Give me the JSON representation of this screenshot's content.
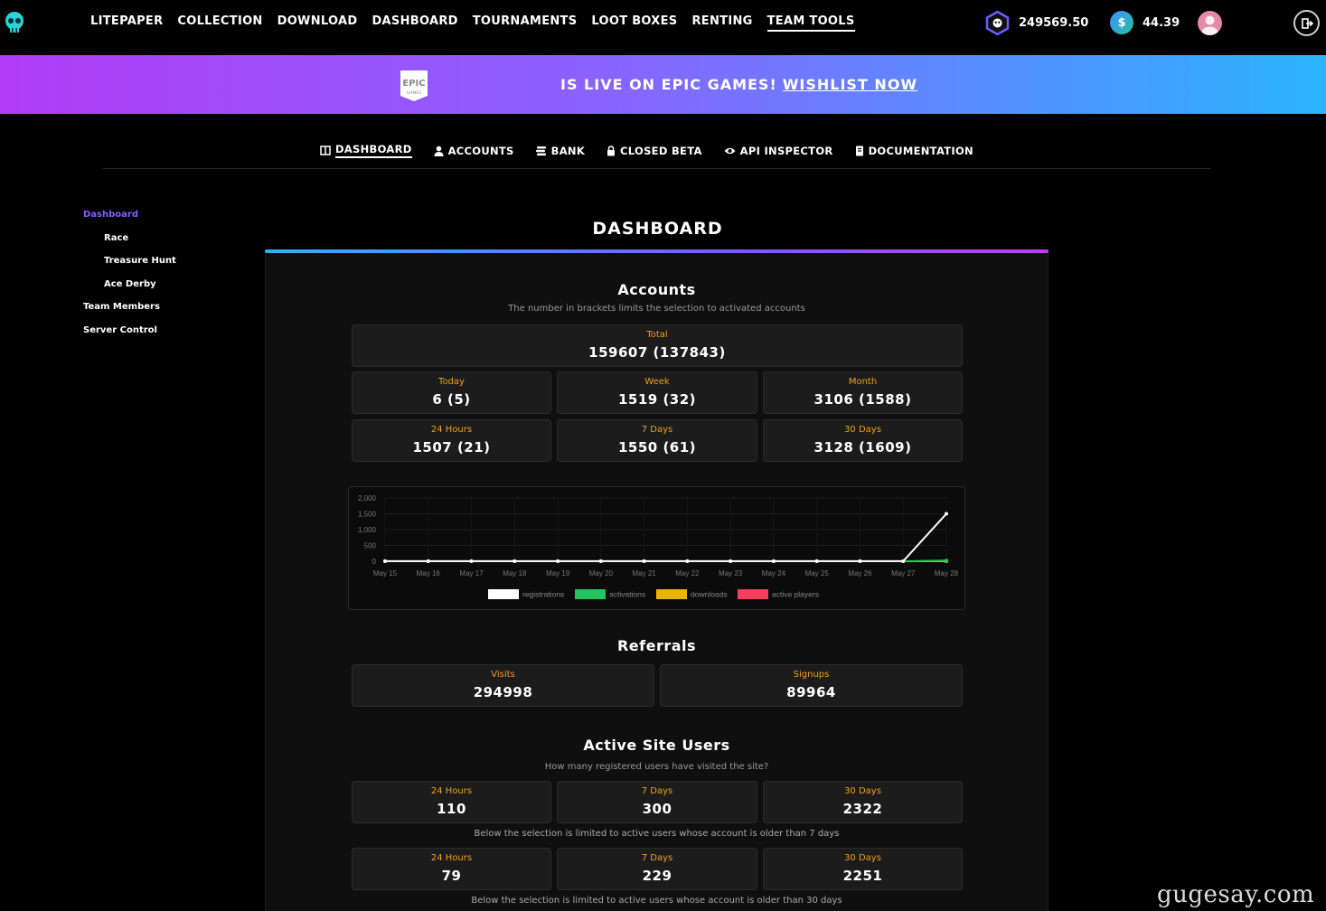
{
  "nav": {
    "links": [
      "LITEPAPER",
      "COLLECTION",
      "DOWNLOAD",
      "DASHBOARD",
      "TOURNAMENTS",
      "LOOT BOXES",
      "RENTING",
      "TEAM TOOLS"
    ],
    "active": "TEAM TOOLS",
    "hex_balance": "249569.50",
    "usd_balance": "44.39",
    "usd_symbol": "$"
  },
  "banner": {
    "logo_text": "EPIC",
    "logo_subtext": "GAMES",
    "text": "IS LIVE ON EPIC GAMES!",
    "link": "WISHLIST NOW"
  },
  "subnav": {
    "items": [
      {
        "label": "DASHBOARD",
        "icon": "columns-icon",
        "active": true
      },
      {
        "label": "ACCOUNTS",
        "icon": "user-icon"
      },
      {
        "label": "BANK",
        "icon": "coins-icon"
      },
      {
        "label": "CLOSED BETA",
        "icon": "lock-icon"
      },
      {
        "label": "API INSPECTOR",
        "icon": "eye-icon"
      },
      {
        "label": "DOCUMENTATION",
        "icon": "book-icon"
      }
    ]
  },
  "sidebar": {
    "items": [
      {
        "label": "Dashboard",
        "active": true
      },
      {
        "label": "Race",
        "sub": true
      },
      {
        "label": "Treasure Hunt",
        "sub": true
      },
      {
        "label": "Ace Derby",
        "sub": true
      },
      {
        "label": "Team Members"
      },
      {
        "label": "Server Control"
      }
    ]
  },
  "page_title": "DASHBOARD",
  "accounts": {
    "title": "Accounts",
    "subtitle": "The number in brackets limits the selection to activated accounts",
    "total": {
      "label": "Total",
      "value": "159607 (137843)"
    },
    "row1": [
      {
        "label": "Today",
        "value": "6 (5)"
      },
      {
        "label": "Week",
        "value": "1519 (32)"
      },
      {
        "label": "Month",
        "value": "3106 (1588)"
      }
    ],
    "row2": [
      {
        "label": "24 Hours",
        "value": "1507 (21)"
      },
      {
        "label": "7 Days",
        "value": "1550 (61)"
      },
      {
        "label": "30 Days",
        "value": "3128 (1609)"
      }
    ]
  },
  "chart_data": {
    "type": "line",
    "x": [
      "May 15",
      "May 16",
      "May 17",
      "May 18",
      "May 19",
      "May 20",
      "May 21",
      "May 22",
      "May 23",
      "May 24",
      "May 25",
      "May 26",
      "May 27",
      "May 28"
    ],
    "ylim": [
      0,
      2000
    ],
    "yticks": [
      "2,000",
      "1,500",
      "1,000",
      "500",
      "0"
    ],
    "series": [
      {
        "name": "registrations",
        "color": "#ffffff",
        "values": [
          5,
          2,
          2,
          2,
          2,
          2,
          2,
          2,
          2,
          2,
          2,
          2,
          2,
          1500
        ]
      },
      {
        "name": "activations",
        "color": "#22c55e",
        "values": [
          0,
          0,
          0,
          0,
          0,
          0,
          0,
          0,
          0,
          0,
          0,
          0,
          0,
          20
        ]
      },
      {
        "name": "downloads",
        "color": "#eab308",
        "values": [
          0,
          0,
          0,
          0,
          0,
          0,
          0,
          0,
          0,
          0,
          0,
          0,
          0,
          0
        ]
      },
      {
        "name": "active players",
        "color": "#f43f5e",
        "values": [
          0,
          0,
          0,
          0,
          0,
          0,
          0,
          0,
          0,
          0,
          0,
          0,
          0,
          0
        ]
      }
    ],
    "grid": true,
    "legend": "bottom"
  },
  "referrals": {
    "title": "Referrals",
    "cards": [
      {
        "label": "Visits",
        "value": "294998"
      },
      {
        "label": "Signups",
        "value": "89964"
      }
    ]
  },
  "active_users": {
    "title": "Active Site Users",
    "subtitle": "How many registered users have visited the site?",
    "row1": [
      {
        "label": "24 Hours",
        "value": "110"
      },
      {
        "label": "7 Days",
        "value": "300"
      },
      {
        "label": "30 Days",
        "value": "2322"
      }
    ],
    "note1": "Below the selection is limited to active users whose account is older than 7 days",
    "row2": [
      {
        "label": "24 Hours",
        "value": "79"
      },
      {
        "label": "7 Days",
        "value": "229"
      },
      {
        "label": "30 Days",
        "value": "2251"
      }
    ],
    "note2": "Below the selection is limited to active users whose account is older than 30 days"
  },
  "watermark": "gugesay.com"
}
